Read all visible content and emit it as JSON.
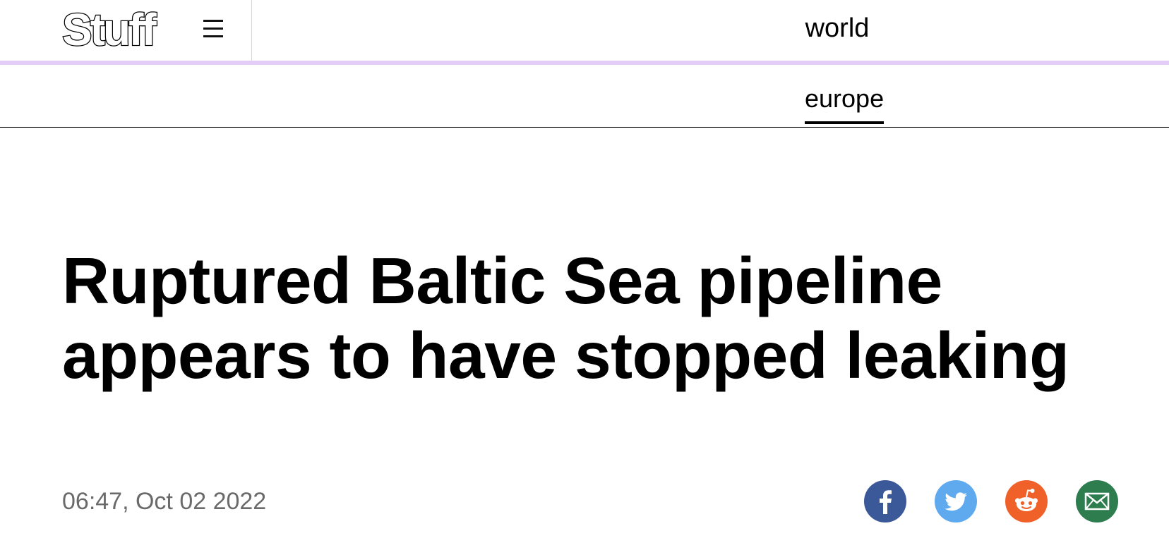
{
  "header": {
    "logo_text": "Stuff",
    "section": "world"
  },
  "subnav": {
    "active_item": "europe"
  },
  "article": {
    "headline": "Ruptured Baltic Sea pipeline appears to have stopped leaking",
    "timestamp": "06:47, Oct 02 2022"
  },
  "share": {
    "icons": [
      "facebook-icon",
      "twitter-icon",
      "reddit-icon",
      "email-icon"
    ],
    "colors": {
      "facebook": "#3b5998",
      "twitter": "#5fa9ee",
      "reddit": "#f0612a",
      "email": "#2e7d4f"
    }
  },
  "colors": {
    "accent_bar": "#e3ccf7",
    "timestamp": "#6a6a6a"
  }
}
